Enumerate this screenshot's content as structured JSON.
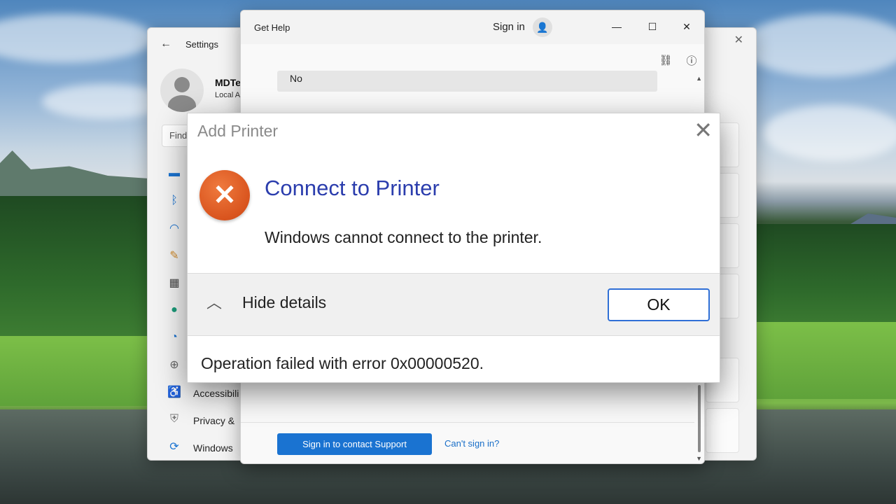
{
  "settings": {
    "title": "Settings",
    "user_name": "MDTe",
    "user_sub": "Local A",
    "find_placeholder": "Find",
    "nav": [
      {
        "icon": "system-icon",
        "label": ""
      },
      {
        "icon": "bluetooth-icon",
        "label": ""
      },
      {
        "icon": "wifi-icon",
        "label": ""
      },
      {
        "icon": "personalization-brush-icon",
        "label": ""
      },
      {
        "icon": "apps-icon",
        "label": ""
      },
      {
        "icon": "accounts-person-icon",
        "label": ""
      },
      {
        "icon": "time-language-icon",
        "label": ""
      },
      {
        "icon": "gaming-controller-icon",
        "label": ""
      },
      {
        "icon": "accessibility-icon",
        "label": "Accessibili"
      },
      {
        "icon": "privacy-shield-icon",
        "label": "Privacy &"
      },
      {
        "icon": "windows-update-icon",
        "label": "Windows"
      }
    ]
  },
  "gethelp": {
    "title": "Get Help",
    "signin": "Sign in",
    "no_option": "No",
    "support_button": "Sign in to contact Support",
    "cant_sign_in": "Can't sign in?"
  },
  "dialog": {
    "title": "Add Printer",
    "heading": "Connect to Printer",
    "message": "Windows cannot connect to the printer.",
    "hide_details": "Hide details",
    "ok": "OK",
    "error_text": "Operation failed with error 0x00000520."
  }
}
